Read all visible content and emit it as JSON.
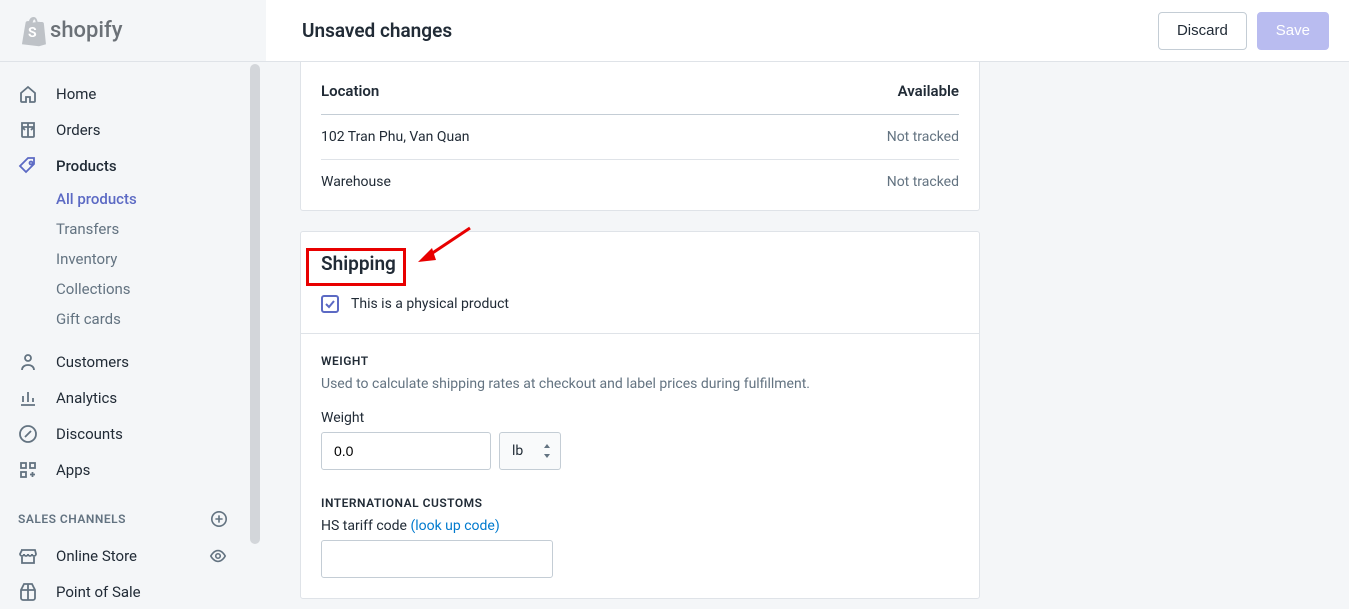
{
  "topbar": {
    "logo_text": "shopify",
    "title": "Unsaved changes",
    "discard_label": "Discard",
    "save_label": "Save"
  },
  "sidebar": {
    "home": "Home",
    "orders": "Orders",
    "products": "Products",
    "sub": {
      "all_products": "All products",
      "transfers": "Transfers",
      "inventory": "Inventory",
      "collections": "Collections",
      "gift_cards": "Gift cards"
    },
    "customers": "Customers",
    "analytics": "Analytics",
    "discounts": "Discounts",
    "apps": "Apps",
    "sales_channels_header": "SALES CHANNELS",
    "online_store": "Online Store",
    "point_of_sale": "Point of Sale"
  },
  "inventory": {
    "header_location": "Location",
    "header_available": "Available",
    "rows": [
      {
        "location": "102 Tran Phu, Van Quan",
        "available": "Not tracked"
      },
      {
        "location": "Warehouse",
        "available": "Not tracked"
      }
    ]
  },
  "shipping": {
    "title": "Shipping",
    "physical_label": "This is a physical product",
    "weight": {
      "section_title": "WEIGHT",
      "desc": "Used to calculate shipping rates at checkout and label prices during fulfillment.",
      "label": "Weight",
      "value": "0.0",
      "unit": "lb"
    },
    "customs": {
      "section_title": "INTERNATIONAL CUSTOMS",
      "hs_label_prefix": "HS tariff code ",
      "hs_link": "(look up code)"
    }
  }
}
